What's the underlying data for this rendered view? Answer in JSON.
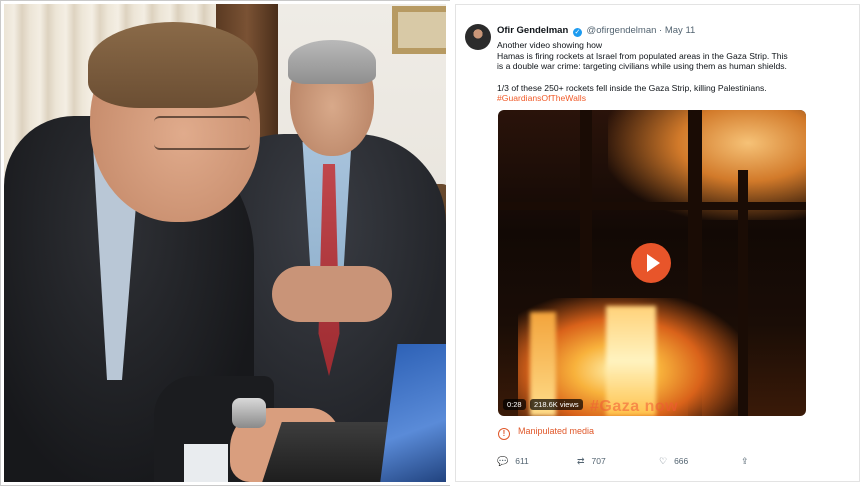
{
  "tweet": {
    "author_name": "Ofir Gendelman",
    "handle": "@ofirgendelman",
    "separator": "·",
    "date": "May 11",
    "text_lines": [
      "Another video showing how",
      "Hamas is firing rockets at Israel from populated areas in the Gaza Strip. This",
      "is a double war crime: targeting civilians while using them as human shields."
    ],
    "text_second": "1/3 of these 250+ rockets fell inside the Gaza Strip, killing Palestinians.",
    "hashtag": "#GuardiansOfTheWalls",
    "video": {
      "duration": "0:28",
      "views": "218.6K views",
      "watermark": "#Gaza now"
    },
    "label": "Manipulated media",
    "actions": {
      "replies": "611",
      "retweets": "707",
      "likes": "666"
    }
  },
  "icons": {
    "verified": "verified-badge-icon",
    "play": "play-icon",
    "manipulated": "alert-circle-icon",
    "reply": "reply-icon",
    "retweet": "retweet-icon",
    "like": "heart-icon",
    "share": "share-icon"
  },
  "colors": {
    "accent_orange": "#e0582a",
    "verified_blue": "#1d9bf0",
    "text_primary": "#0f1419",
    "text_secondary": "#536471"
  }
}
